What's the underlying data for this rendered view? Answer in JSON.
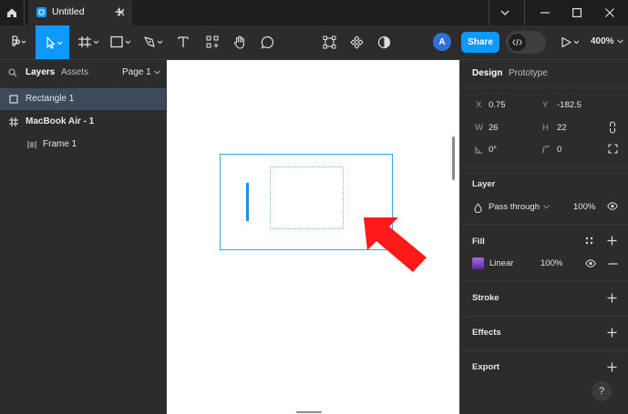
{
  "titlebar": {
    "tab_title": "Untitled",
    "icons": [
      "home-icon",
      "close-icon",
      "plus-icon",
      "chevron-down-icon",
      "minimize-icon",
      "maximize-icon",
      "close-icon"
    ]
  },
  "toolbar": {
    "share_label": "Share",
    "avatar_initial": "A",
    "zoom": "400%",
    "accent_color": "#0d99ff"
  },
  "left_panel": {
    "tabs": {
      "layers": "Layers",
      "assets": "Assets"
    },
    "page_selector": "Page 1",
    "layers": [
      {
        "label": "Rectangle 1",
        "selected": true
      },
      {
        "label": "MacBook Air - 1",
        "selected": false
      },
      {
        "label": "Frame 1",
        "selected": false
      }
    ]
  },
  "right_panel": {
    "tabs": {
      "design": "Design",
      "prototype": "Prototype"
    },
    "geometry": {
      "x_label": "X",
      "x_value": "0.75",
      "y_label": "Y",
      "y_value": "-182.5",
      "w_label": "W",
      "w_value": "26",
      "h_label": "H",
      "h_value": "22",
      "rotation_value": "0°",
      "radius_value": "0"
    },
    "layer": {
      "heading": "Layer",
      "blend_mode": "Pass through",
      "opacity": "100%"
    },
    "fill": {
      "heading": "Fill",
      "type": "Linear",
      "opacity": "100%",
      "swatch_color": "#7b3fc4"
    },
    "stroke_heading": "Stroke",
    "effects_heading": "Effects",
    "export_heading": "Export",
    "help_label": "?"
  },
  "annotation": {
    "arrow_color": "#ff0000"
  }
}
